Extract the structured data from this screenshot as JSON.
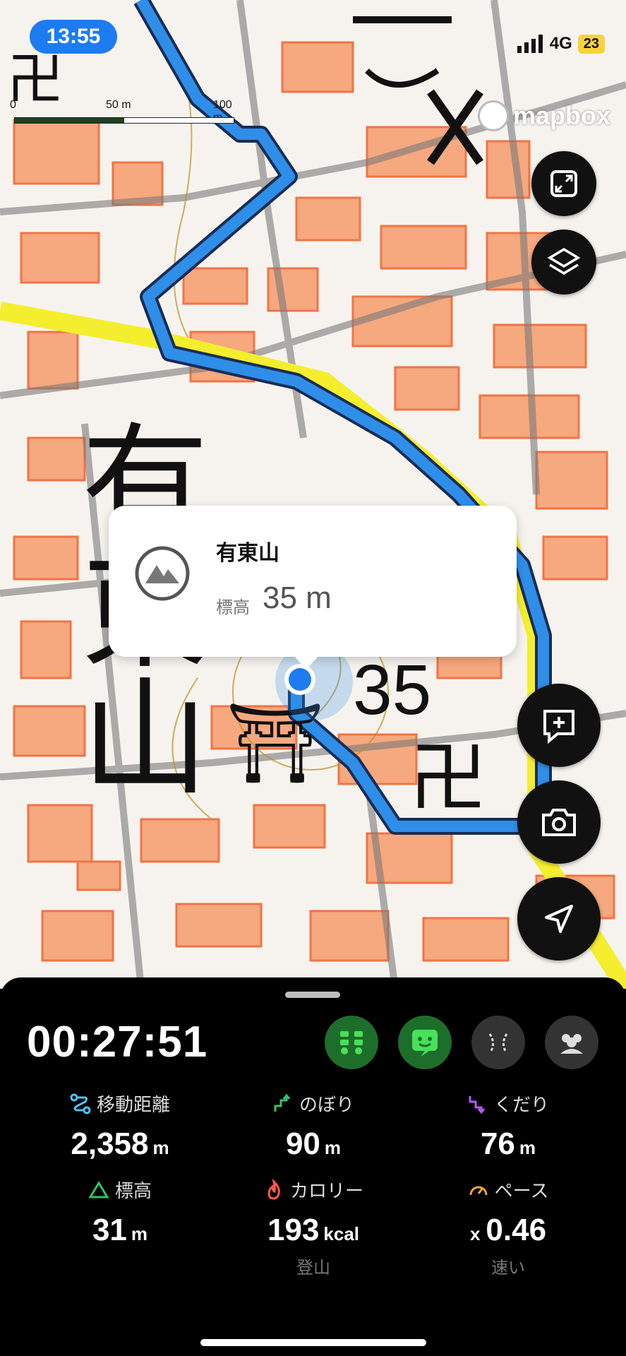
{
  "status_bar": {
    "time": "13:55",
    "network": "4G",
    "battery": "23"
  },
  "map": {
    "scale_labels": [
      "0",
      "50 m",
      "100 m"
    ],
    "attribution": "mapbox",
    "map_labels": {
      "mountain_name": "有東山",
      "spot_height": "35"
    }
  },
  "popup": {
    "name": "有東山",
    "elevation_label": "標高",
    "elevation_value": "35 m"
  },
  "panel": {
    "timer": "00:27:51",
    "stats": {
      "distance": {
        "label": "移動距離",
        "value": "2,358",
        "unit": "m"
      },
      "ascent": {
        "label": "のぼり",
        "value": "90",
        "unit": "m"
      },
      "descent": {
        "label": "くだり",
        "value": "76",
        "unit": "m"
      },
      "elevation": {
        "label": "標高",
        "value": "31",
        "unit": "m"
      },
      "calories": {
        "label": "カロリー",
        "value": "193",
        "unit": "kcal",
        "sub": "登山"
      },
      "pace": {
        "label": "ペース",
        "prefix": "x",
        "value": "0.46",
        "sub": "速い"
      }
    }
  },
  "colors": {
    "accent": "#1e7bf0",
    "route": "#2e8ee8",
    "mode_active": "#34c85a"
  }
}
